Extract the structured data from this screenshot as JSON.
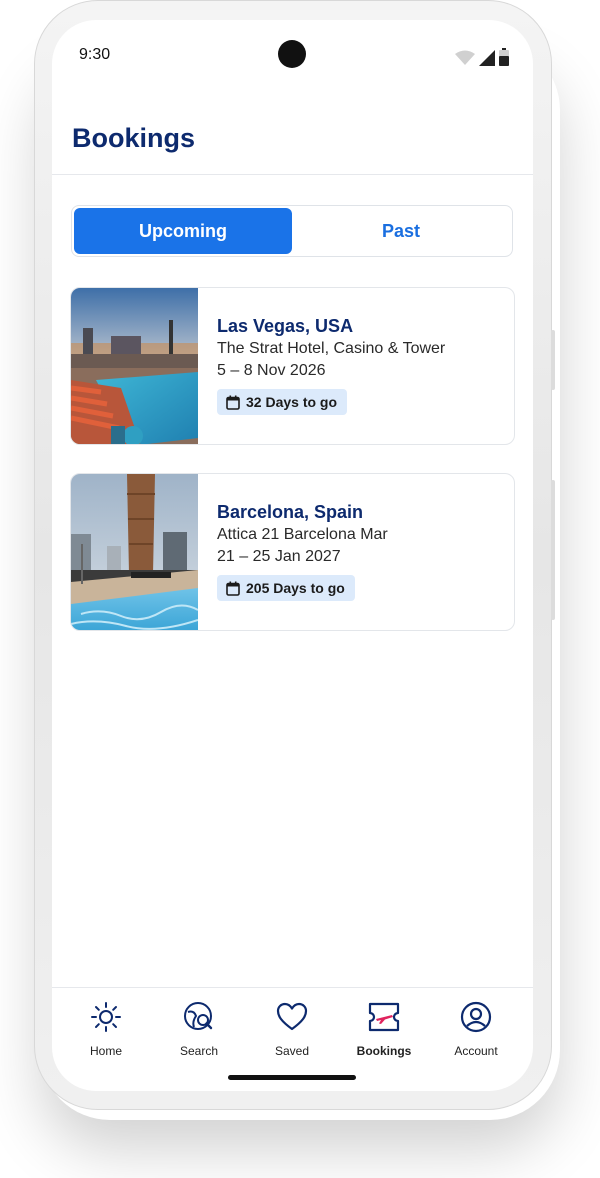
{
  "status_bar": {
    "time": "9:30"
  },
  "header": {
    "title": "Bookings"
  },
  "segmented": {
    "upcoming": "Upcoming",
    "past": "Past"
  },
  "bookings": [
    {
      "city": "Las Vegas, USA",
      "hotel": "The Strat Hotel, Casino & Tower",
      "dates": "5 – 8 Nov 2026",
      "countdown": "32 Days to go",
      "image": "hotel-pool-sunset-photo"
    },
    {
      "city": "Barcelona, Spain",
      "hotel": "Attica 21 Barcelona Mar",
      "dates": "21 – 25 Jan 2027",
      "countdown": "205 Days to go",
      "image": "hotel-pool-tower-photo"
    }
  ],
  "tabbar": {
    "items": [
      {
        "label": "Home",
        "icon": "sun-icon"
      },
      {
        "label": "Search",
        "icon": "globe-search-icon"
      },
      {
        "label": "Saved",
        "icon": "heart-icon"
      },
      {
        "label": "Bookings",
        "icon": "ticket-plane-icon",
        "active": true
      },
      {
        "label": "Account",
        "icon": "user-circle-icon"
      }
    ]
  },
  "colors": {
    "primary": "#1a73e8",
    "navy": "#0d2a6e",
    "badge_bg": "#dceafb",
    "accent_pink": "#e0245e"
  }
}
